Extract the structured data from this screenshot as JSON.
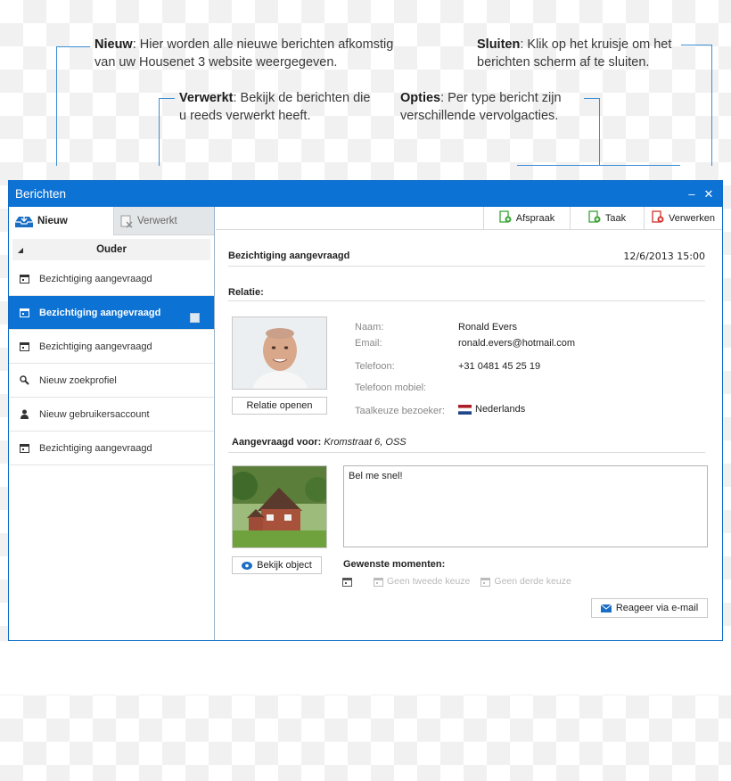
{
  "annotations": {
    "nieuw": {
      "term": "Nieuw",
      "text": ": Hier worden alle nieuwe berichten afkomstig van uw Housenet 3 website weergegeven."
    },
    "verwerkt": {
      "term": "Verwerkt",
      "text": ": Bekijk de berichten die u reeds verwerkt heeft."
    },
    "opties": {
      "term": "Opties",
      "text": ": Per type bericht zijn verschillende vervolgacties."
    },
    "sluiten": {
      "term": "Sluiten",
      "text": ": Klik op het kruisje om het berichten scherm af te sluiten."
    }
  },
  "window": {
    "title": "Berichten",
    "minimize": "–",
    "close": "✕"
  },
  "tabs": [
    {
      "label": "Nieuw",
      "icon": "inbox-icon"
    },
    {
      "label": "Verwerkt",
      "icon": "processed-icon"
    }
  ],
  "group": {
    "label": "Ouder",
    "icon": "collapse-arrow-icon"
  },
  "messages": [
    {
      "label": "Bezichtiging aangevraagd",
      "icon": "calendar-icon",
      "selected": false
    },
    {
      "label": "Bezichtiging aangevraagd",
      "icon": "calendar-icon",
      "selected": true
    },
    {
      "label": "Bezichtiging aangevraagd",
      "icon": "calendar-icon",
      "selected": false
    },
    {
      "label": "Nieuw zoekprofiel",
      "icon": "search-icon",
      "selected": false
    },
    {
      "label": "Nieuw gebruikersaccount",
      "icon": "user-icon",
      "selected": false
    },
    {
      "label": "Bezichtiging aangevraagd",
      "icon": "calendar-icon",
      "selected": false
    }
  ],
  "actions": [
    {
      "label": "Afspraak",
      "icon": "appointment-icon",
      "color": "#3aa335"
    },
    {
      "label": "Taak",
      "icon": "task-icon",
      "color": "#3aa335"
    },
    {
      "label": "Verwerken",
      "icon": "process-icon",
      "color": "#d0302a"
    }
  ],
  "detail": {
    "subject": "Bezichtiging aangevraagd",
    "date": "12/6/2013 15:00",
    "relation_heading": "Relatie:",
    "open_relation_button": "Relatie openen",
    "fields": [
      {
        "label": "Naam:",
        "value": "Ronald Evers"
      },
      {
        "label": "Email:",
        "value": "ronald.evers@hotmail.com"
      },
      {
        "label": "Telefoon:",
        "value": "+31 0481 45 25 19"
      },
      {
        "label": "Telefoon mobiel:",
        "value": ""
      },
      {
        "label": "Taalkeuze bezoeker:",
        "value": "Nederlands"
      }
    ],
    "requested_for_label": "Aangevraagd voor:",
    "requested_for_value": "Kromstraat 6",
    "requested_for_city": ", OSS",
    "view_object_button": "Bekijk object",
    "message": "Bel me snel!",
    "moments_heading": "Gewenste momenten:",
    "moments": [
      "",
      "Geen tweede keuze",
      "Geen derde keuze"
    ],
    "reply_button": "Reageer via e-mail"
  },
  "colors": {
    "accent": "#0c72d4",
    "callout_line": "#3b8fd6",
    "green_action": "#3aa335",
    "red_action": "#d0302a"
  }
}
